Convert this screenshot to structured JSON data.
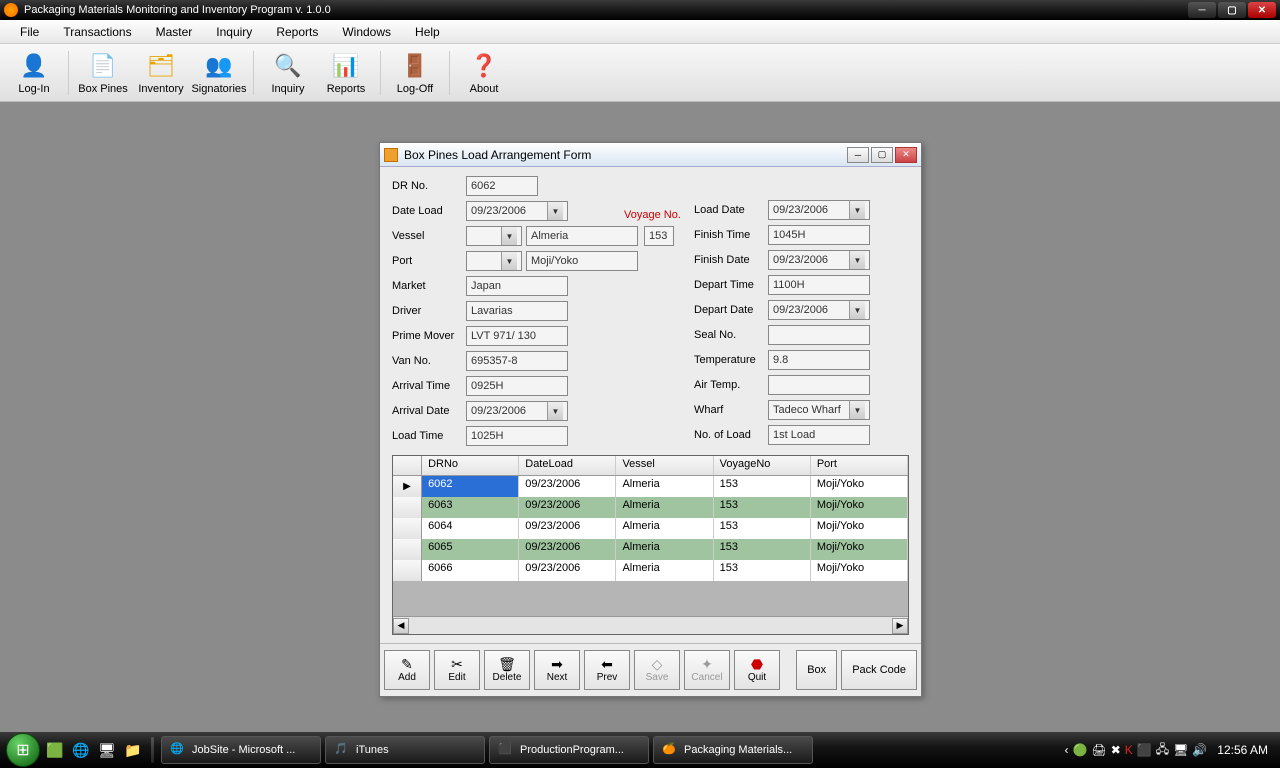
{
  "app": {
    "title": "Packaging Materials Monitoring and Inventory Program v. 1.0.0"
  },
  "menubar": {
    "items": [
      "File",
      "Transactions",
      "Master",
      "Inquiry",
      "Reports",
      "Windows",
      "Help"
    ]
  },
  "toolbar": {
    "items": [
      {
        "name": "login",
        "label": "Log-In",
        "icon": "👤"
      },
      {
        "name": "boxpines",
        "label": "Box Pines",
        "icon": "📄"
      },
      {
        "name": "inventory",
        "label": "Inventory",
        "icon": "🗂"
      },
      {
        "name": "signatories",
        "label": "Signatories",
        "icon": "👥"
      },
      {
        "name": "inquiry",
        "label": "Inquiry",
        "icon": "🔍"
      },
      {
        "name": "reports",
        "label": "Reports",
        "icon": "📊"
      },
      {
        "name": "logoff",
        "label": "Log-Off",
        "icon": "🚪"
      },
      {
        "name": "about",
        "label": "About",
        "icon": "❓"
      }
    ]
  },
  "form": {
    "title": "Box Pines Load Arrangement Form",
    "voyage_label": "Voyage No.",
    "left_labels": {
      "dr_no": "DR No.",
      "date_load": "Date Load",
      "vessel": "Vessel",
      "port": "Port",
      "market": "Market",
      "driver": "Driver",
      "prime_mover": "Prime Mover",
      "van_no": "Van No.",
      "arrival_time": "Arrival Time",
      "arrival_date": "Arrival Date",
      "load_time": "Load Time"
    },
    "right_labels": {
      "load_date": "Load Date",
      "finish_time": "Finish Time",
      "finish_date": "Finish Date",
      "depart_time": "Depart Time",
      "depart_date": "Depart Date",
      "seal_no": "Seal No.",
      "temperature": "Temperature",
      "air_temp": "Air Temp.",
      "wharf": "Wharf",
      "no_of_load": "No. of Load"
    },
    "values": {
      "dr_no": "6062",
      "date_load": "09/23/2006",
      "vessel_code": "",
      "vessel_name": "Almeria",
      "voyage_no": "153",
      "port_code": "",
      "port_name": "Moji/Yoko",
      "market": "Japan",
      "driver": "Lavarias",
      "prime_mover": "LVT 971/ 130",
      "van_no": "695357-8",
      "arrival_time": "0925H",
      "arrival_date": "09/23/2006",
      "load_time": "1025H",
      "load_date": "09/23/2006",
      "finish_time": "1045H",
      "finish_date": "09/23/2006",
      "depart_time": "1100H",
      "depart_date": "09/23/2006",
      "seal_no": "",
      "temperature": "9.8",
      "air_temp": "",
      "wharf": "Tadeco Wharf",
      "no_of_load": "1st Load"
    },
    "grid": {
      "headers": {
        "dr": "DRNo",
        "dl": "DateLoad",
        "vs": "Vessel",
        "vn": "VoyageNo",
        "pt": "Port"
      },
      "rows": [
        {
          "dr": "6062",
          "dl": "09/23/2006",
          "vs": "Almeria",
          "vn": "153",
          "pt": "Moji/Yoko",
          "selected": true
        },
        {
          "dr": "6063",
          "dl": "09/23/2006",
          "vs": "Almeria",
          "vn": "153",
          "pt": "Moji/Yoko"
        },
        {
          "dr": "6064",
          "dl": "09/23/2006",
          "vs": "Almeria",
          "vn": "153",
          "pt": "Moji/Yoko"
        },
        {
          "dr": "6065",
          "dl": "09/23/2006",
          "vs": "Almeria",
          "vn": "153",
          "pt": "Moji/Yoko"
        },
        {
          "dr": "6066",
          "dl": "09/23/2006",
          "vs": "Almeria",
          "vn": "153",
          "pt": "Moji/Yoko"
        }
      ]
    },
    "buttons": {
      "add": "Add",
      "edit": "Edit",
      "delete": "Delete",
      "next": "Next",
      "prev": "Prev",
      "save": "Save",
      "cancel": "Cancel",
      "quit": "Quit",
      "box": "Box",
      "packcode": "Pack Code"
    }
  },
  "taskbar": {
    "tasks": [
      {
        "label": "JobSite - Microsoft ...",
        "icon": "🌐"
      },
      {
        "label": "iTunes",
        "icon": "🎵"
      },
      {
        "label": "ProductionProgram...",
        "icon": "⬛"
      },
      {
        "label": "Packaging Materials...",
        "icon": "🍊"
      }
    ],
    "clock": "12:56 AM"
  }
}
